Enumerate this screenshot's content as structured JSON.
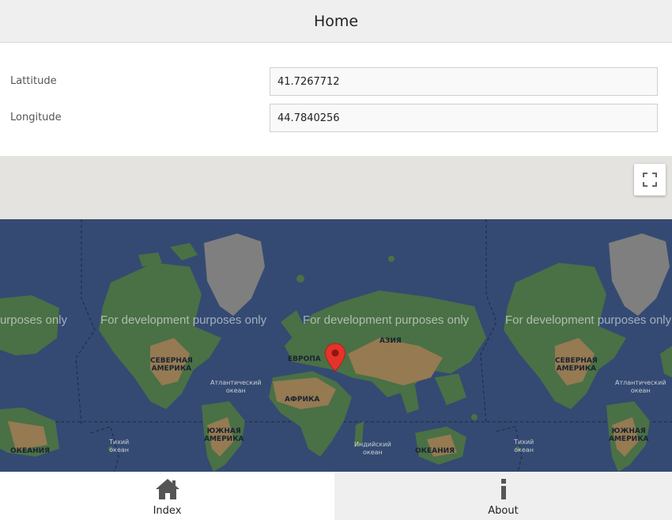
{
  "header": {
    "title": "Home"
  },
  "form": {
    "latitude": {
      "label": "Lattitude",
      "value": "41.7267712"
    },
    "longitude": {
      "label": "Longitude",
      "value": "44.7840256"
    }
  },
  "map": {
    "watermark": "For development purposes only",
    "labels": {
      "north_america": "СЕВЕРНАЯ\nАМЕРИКА",
      "south_america": "ЮЖНАЯ\nАМЕРИКА",
      "europe": "ЕВРОПА",
      "asia": "АЗИЯ",
      "africa": "АФРИКА",
      "oceania": "ОКЕАНИЯ",
      "atlantic": "Атлантический\nокеан",
      "pacific": "Тихий\nокеан",
      "indian": "Индийский\nокеан"
    },
    "colors": {
      "ocean": "#344a72",
      "land": "#4a7046",
      "desert": "#957a52",
      "ice": "#7f7f7f",
      "marker": "#e5332a"
    },
    "fullscreen_icon": "fullscreen-icon",
    "marker_icon": "map-pin-icon"
  },
  "tabs": [
    {
      "label": "Index",
      "icon": "home-icon",
      "selected": true
    },
    {
      "label": "About",
      "icon": "info-icon",
      "selected": false
    }
  ]
}
